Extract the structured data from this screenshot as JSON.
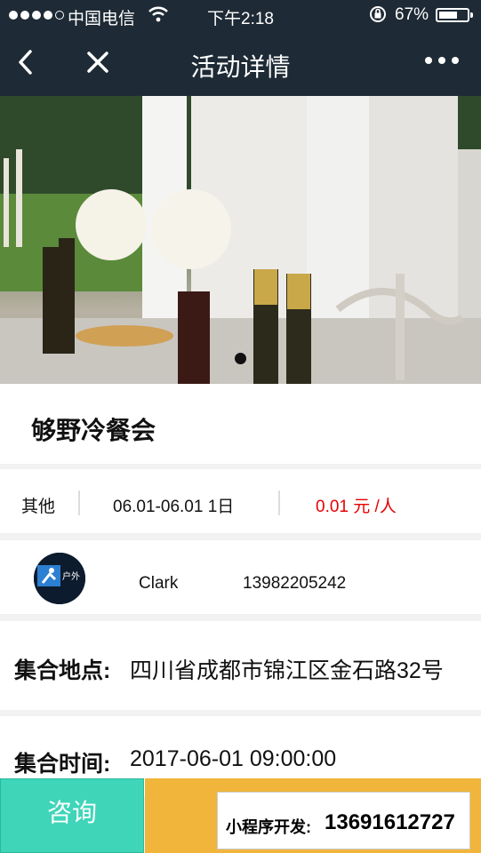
{
  "status_bar": {
    "carrier": "中国电信",
    "time": "下午2:18",
    "battery": "67%",
    "battery_level": 0.67
  },
  "nav": {
    "title": "活动详情"
  },
  "banner": {
    "slide_count": 1,
    "active_slide": 1
  },
  "activity": {
    "title": "够野冷餐会",
    "category": "其他",
    "date_range": "06.01-06.01 1日",
    "price": "0.01 元 /人"
  },
  "organizer": {
    "name": "Clark",
    "phone": "13982205242",
    "logo_text": "户外"
  },
  "details": {
    "location_label": "集合地点:",
    "location_value": "四川省成都市锦江区金石路32号",
    "time_label": "集合时间:",
    "time_value": "2017-06-01 09:00:00"
  },
  "bottom": {
    "consult_label": "咨询",
    "promo_label": "小程序开发:",
    "promo_phone": "13691612727"
  },
  "colors": {
    "nav_bg": "#1e2a35",
    "price_red": "#e60000",
    "consult_teal": "#3ed5b9",
    "signup_orange": "#f0b53a"
  }
}
